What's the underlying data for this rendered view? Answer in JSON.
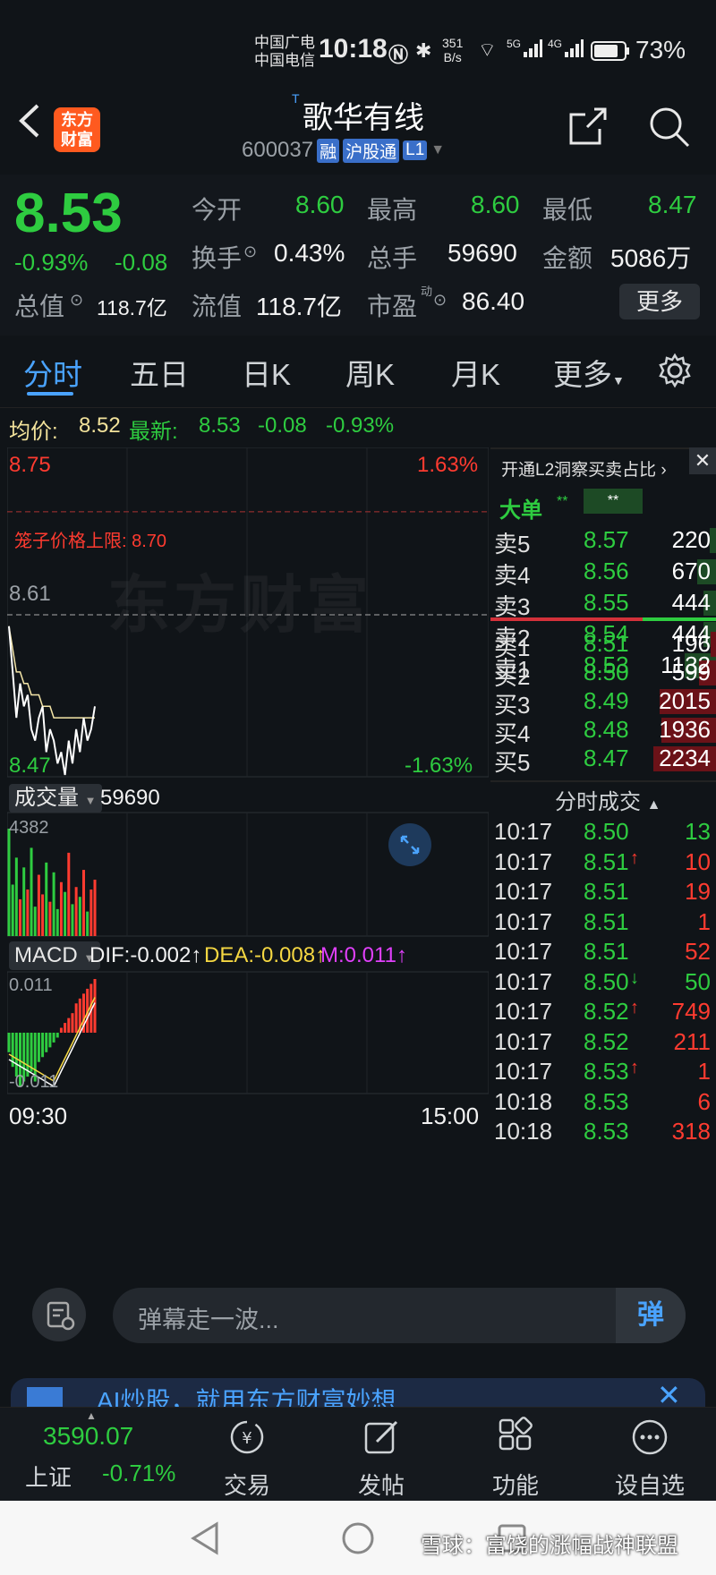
{
  "status": {
    "carrier1": "中国广电",
    "carrier2": "中国电信",
    "time": "10:18",
    "net_speed": "351",
    "net_unit": "B/s",
    "sig1": "5G",
    "sig2": "4G",
    "battery": "73%"
  },
  "header": {
    "back_label": "<",
    "logo_line1": "东方",
    "logo_line2": "财富",
    "title_marker": "T",
    "title": "歌华有线",
    "code": "600037",
    "badge_rong": "融",
    "badge_hgt": "沪股通",
    "badge_l1": "L1"
  },
  "quote": {
    "price": "8.53",
    "change_pct": "-0.93%",
    "change": "-0.08",
    "open_label": "今开",
    "open": "8.60",
    "high_label": "最高",
    "high": "8.60",
    "low_label": "最低",
    "low": "8.47",
    "turnover_label": "换手",
    "turnover": "0.43%",
    "volume_label": "总手",
    "volume": "59690",
    "amount_label": "金额",
    "amount": "5086万",
    "mktcap_label": "总值",
    "mktcap": "118.7亿",
    "float_label": "流值",
    "float": "118.7亿",
    "pe_label": "市盈",
    "pe_sup": "动",
    "pe": "86.40",
    "more": "更多"
  },
  "tabs": [
    "分时",
    "五日",
    "日K",
    "周K",
    "月K",
    "更多"
  ],
  "infoline": {
    "avg_label": "均价:",
    "avg": "8.52",
    "latest_label": "最新:",
    "latest": "8.53",
    "chg": "-0.08",
    "pct": "-0.93%"
  },
  "chart": {
    "y_top": "8.75",
    "y_top_pct": "1.63%",
    "limit_label": "笼子价格上限: 8.70",
    "ref": "8.61",
    "y_bottom": "8.47",
    "y_bottom_pct": "-1.63%",
    "watermark": "东方财富",
    "vol_label": "成交量",
    "vol_value": "59690",
    "vol_max": "4382",
    "macd_label": "MACD",
    "dif": "DIF:-0.002",
    "dea": "DEA:-0.008",
    "m": "M:0.011",
    "macd_top": "0.011",
    "macd_bottom": "-0.011",
    "t_start": "09:30",
    "t_end": "15:00",
    "colors": {
      "up": "#ff3b30",
      "down": "#2ecc40",
      "price_line": "#ffffff",
      "avg_line": "#f5e6a8"
    }
  },
  "chart_data": {
    "type": "line",
    "title": "",
    "xlabel": "",
    "ylabel": "",
    "ylim": [
      8.47,
      8.75
    ],
    "series": [
      {
        "values": [
          8.6,
          8.56,
          8.52,
          8.55,
          8.53,
          8.54,
          8.51,
          8.5,
          8.52,
          8.53,
          8.49,
          8.51,
          8.5,
          8.48,
          8.49,
          8.47,
          8.5,
          8.48,
          8.51,
          8.49,
          8.52,
          8.5,
          8.51,
          8.53
        ]
      },
      {
        "values": [
          8.6,
          8.58,
          8.56,
          8.56,
          8.55,
          8.55,
          8.54,
          8.54,
          8.54,
          8.53,
          8.53,
          8.53,
          8.52,
          8.52,
          8.52,
          8.52,
          8.52,
          8.52,
          8.52,
          8.52,
          8.52,
          8.52,
          8.52,
          8.52
        ]
      }
    ],
    "volume": [
      4382,
      2100,
      3200,
      1500,
      2800,
      1900,
      3600,
      1200,
      2500,
      1700,
      3000,
      1400,
      2600,
      1100,
      2200,
      1800,
      3400,
      1300,
      2000,
      1600,
      2700,
      1000,
      1900,
      2300
    ],
    "macd": [
      -0.004,
      -0.007,
      -0.009,
      -0.011,
      -0.01,
      -0.009,
      -0.008,
      -0.01,
      -0.006,
      -0.005,
      -0.004,
      -0.003,
      -0.002,
      -0.001,
      0.001,
      0.002,
      0.003,
      0.004,
      0.006,
      0.007,
      0.008,
      0.009,
      0.01,
      0.011
    ]
  },
  "book": {
    "header": "开通L2洞察买卖占比",
    "big_label": "大单",
    "big_v1": "**",
    "big_v2": "**",
    "asks": [
      {
        "label": "卖5",
        "price": "8.57",
        "vol": "220"
      },
      {
        "label": "卖4",
        "price": "8.56",
        "vol": "670"
      },
      {
        "label": "卖3",
        "price": "8.55",
        "vol": "444"
      },
      {
        "label": "卖2",
        "price": "8.54",
        "vol": "444"
      },
      {
        "label": "卖1",
        "price": "8.53",
        "vol": "1132"
      }
    ],
    "bids": [
      {
        "label": "买1",
        "price": "8.51",
        "vol": "196"
      },
      {
        "label": "买2",
        "price": "8.50",
        "vol": "599"
      },
      {
        "label": "买3",
        "price": "8.49",
        "vol": "2015"
      },
      {
        "label": "买4",
        "price": "8.48",
        "vol": "1936"
      },
      {
        "label": "买5",
        "price": "8.47",
        "vol": "2234"
      }
    ],
    "ticks_title": "分时成交",
    "ticks": [
      {
        "time": "10:17",
        "price": "8.50",
        "arrow": "",
        "vol": "13",
        "vc": "green"
      },
      {
        "time": "10:17",
        "price": "8.51",
        "arrow": "↑",
        "vol": "10",
        "vc": "red"
      },
      {
        "time": "10:17",
        "price": "8.51",
        "arrow": "",
        "vol": "19",
        "vc": "red"
      },
      {
        "time": "10:17",
        "price": "8.51",
        "arrow": "",
        "vol": "1",
        "vc": "red"
      },
      {
        "time": "10:17",
        "price": "8.51",
        "arrow": "",
        "vol": "52",
        "vc": "red"
      },
      {
        "time": "10:17",
        "price": "8.50",
        "arrow": "↓",
        "vol": "50",
        "vc": "green"
      },
      {
        "time": "10:17",
        "price": "8.52",
        "arrow": "↑",
        "vol": "749",
        "vc": "red"
      },
      {
        "time": "10:17",
        "price": "8.52",
        "arrow": "",
        "vol": "211",
        "vc": "red"
      },
      {
        "time": "10:17",
        "price": "8.53",
        "arrow": "↑",
        "vol": "1",
        "vc": "red"
      },
      {
        "time": "10:18",
        "price": "8.53",
        "arrow": "",
        "vol": "6",
        "vc": "red"
      },
      {
        "time": "10:18",
        "price": "8.53",
        "arrow": "",
        "vol": "318",
        "vc": "red"
      }
    ]
  },
  "danmu": {
    "placeholder": "弹幕走一波...",
    "button": "弹"
  },
  "banner": {
    "text": "AI炒股，就用东方财富妙想"
  },
  "bottomnav": {
    "index_value": "3590.07",
    "index_name": "上证",
    "index_pct": "-0.71%",
    "items": [
      "交易",
      "发帖",
      "功能",
      "设自选"
    ]
  },
  "watermark": "雪球：富饶的涨幅战神联盟"
}
